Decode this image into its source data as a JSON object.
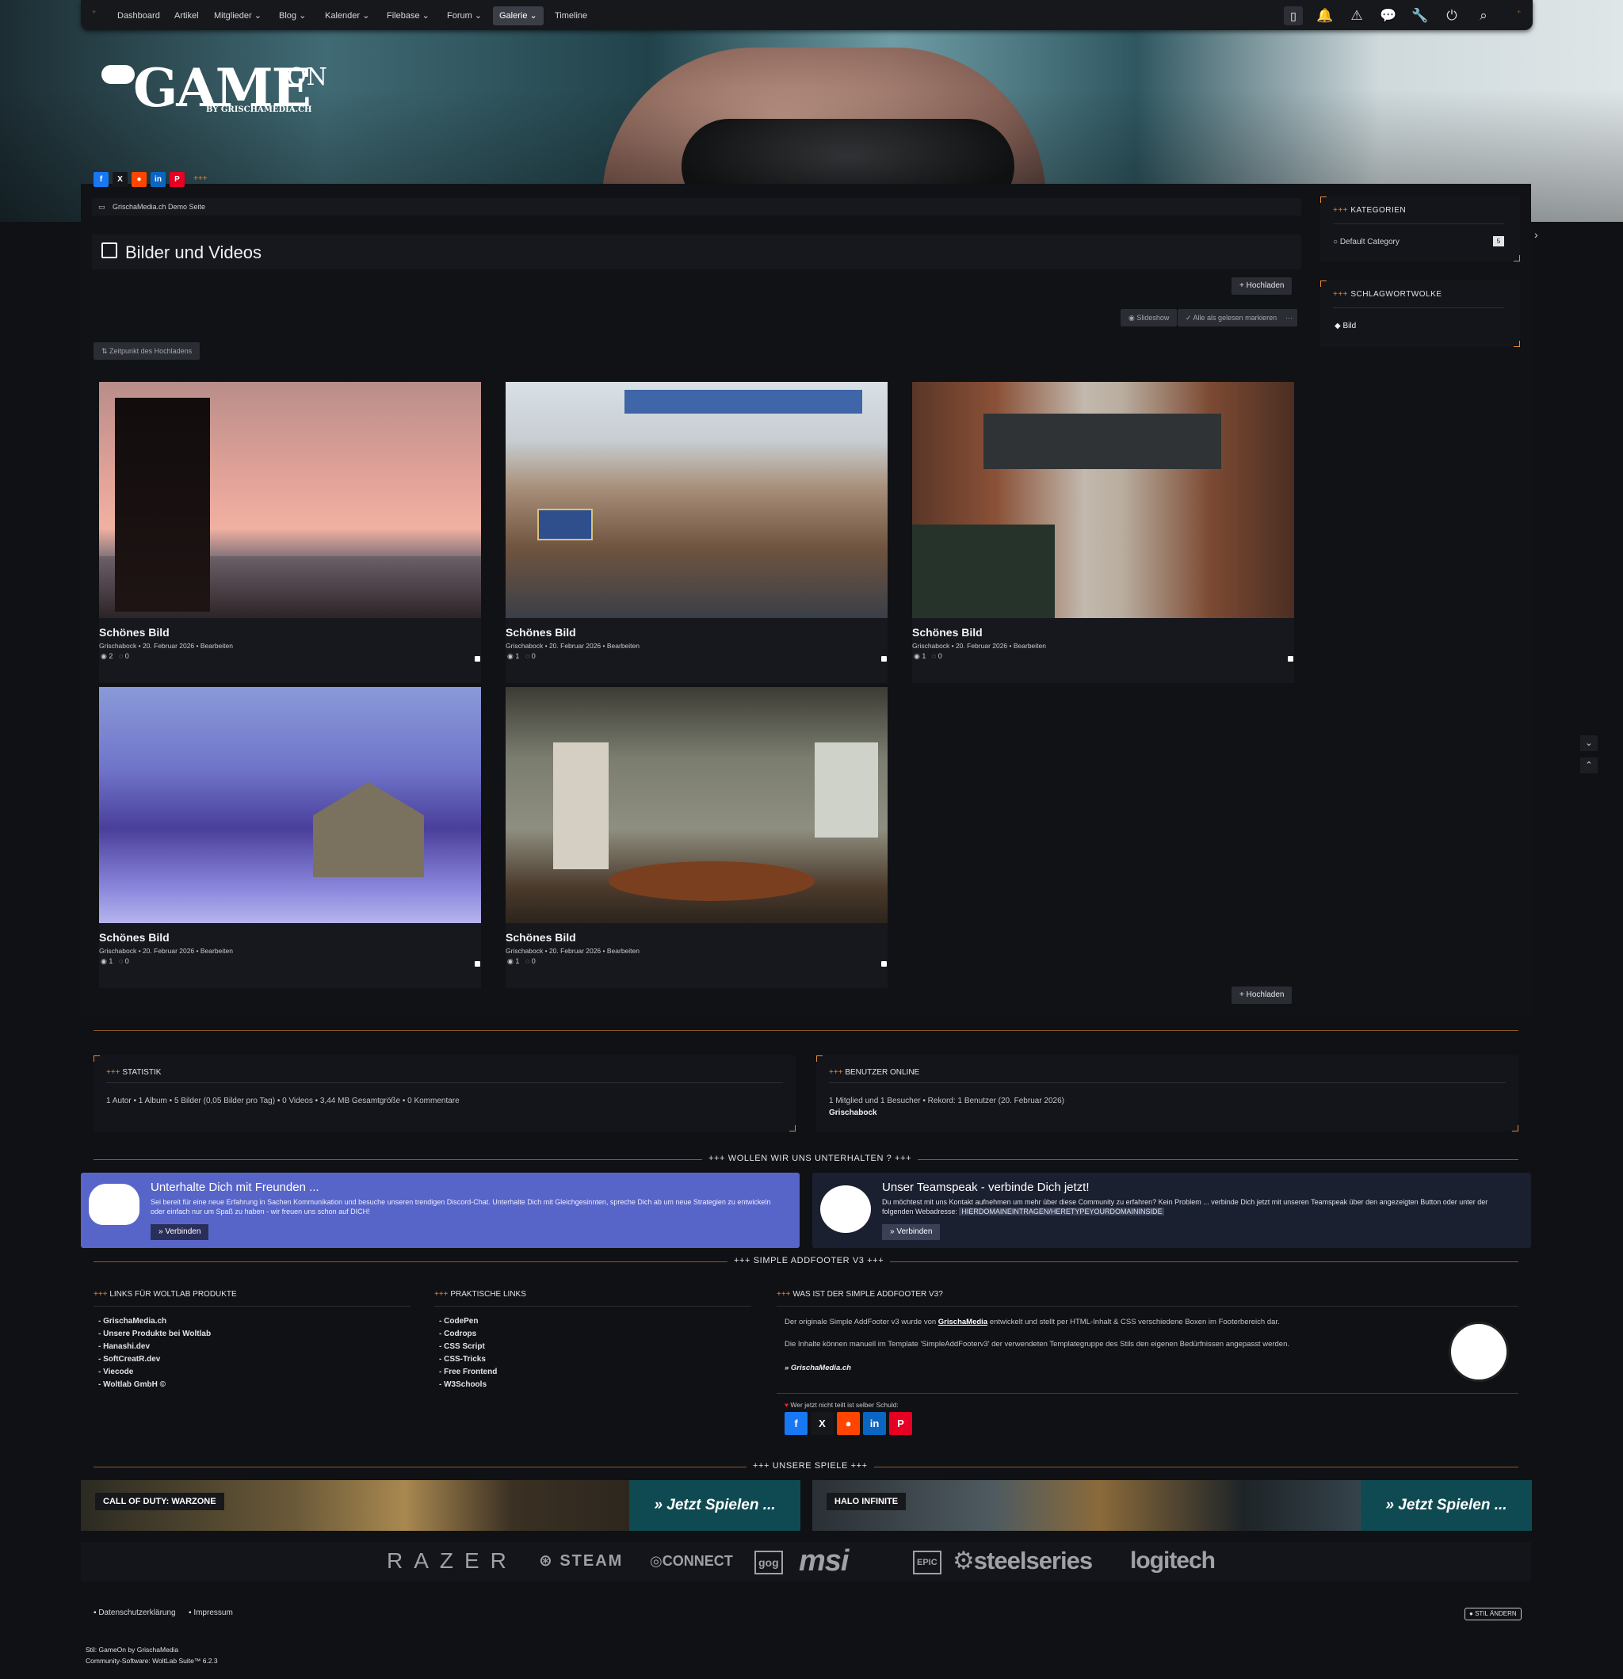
{
  "nav": {
    "items": [
      "Dashboard",
      "Artikel",
      "Mitglieder",
      "Blog",
      "Kalender",
      "Filebase",
      "Forum",
      "Galerie",
      "Timeline"
    ],
    "active": "Galerie",
    "icons": [
      "wsc-logo-icon",
      "bell-icon",
      "warning-icon",
      "chat-icon",
      "wrench-icon",
      "power-icon",
      "search-icon"
    ]
  },
  "logo": {
    "main": "GAMEON",
    "game": "GAME",
    "on": "ON",
    "by": "BY GRISCHAMEDIA.CH"
  },
  "share": {
    "more": "+++"
  },
  "breadcrumb": "GrischaMedia.ch Demo Seite",
  "page_title": "Bilder und Videos",
  "buttons": {
    "upload": "Hochladen",
    "slideshow": "Slideshow",
    "mark_read": "Alle als gelesen markieren",
    "more": "···",
    "sort": "Zeitpunkt des Hochladens"
  },
  "gallery": [
    {
      "title": "Schönes Bild",
      "author": "Grischabock",
      "date": "20. Februar 2026",
      "edit": "Bearbeiten",
      "views": "2",
      "comments": "0"
    },
    {
      "title": "Schönes Bild",
      "author": "Grischabock",
      "date": "20. Februar 2026",
      "edit": "Bearbeiten",
      "views": "1",
      "comments": "0"
    },
    {
      "title": "Schönes Bild",
      "author": "Grischabock",
      "date": "20. Februar 2026",
      "edit": "Bearbeiten",
      "views": "1",
      "comments": "0"
    },
    {
      "title": "Schönes Bild",
      "author": "Grischabock",
      "date": "20. Februar 2026",
      "edit": "Bearbeiten",
      "views": "1",
      "comments": "0"
    },
    {
      "title": "Schönes Bild",
      "author": "Grischabock",
      "date": "20. Februar 2026",
      "edit": "Bearbeiten",
      "views": "1",
      "comments": "0"
    }
  ],
  "sidebar": {
    "categories_title": "KATEGORIEN",
    "category": "Default Category",
    "category_count": "5",
    "tags_title": "SCHLAGWORTWOLKE",
    "tag": "Bild",
    "deco": "+++"
  },
  "stats": {
    "title": "STATISTIK",
    "text": "1 Autor • 1 Album • 5 Bilder (0,05 Bilder pro Tag) • 0 Videos • 3,44 MB Gesamtgröße • 0 Kommentare"
  },
  "online": {
    "title": "BENUTZER ONLINE",
    "text": "1 Mitglied und 1 Besucher • Rekord: 1 Benutzer (20. Februar 2026)",
    "user": "Grischabock"
  },
  "talk": {
    "heading": "+++ WOLLEN WIR UNS UNTERHALTEN ? +++"
  },
  "discord": {
    "title": "Unterhalte Dich mit Freunden ...",
    "text": "Sei bereit für eine neue Erfahrung in Sachen Kommunikation und besuche unseren trendigen Discord-Chat. Unterhalte Dich mit Gleichgesinnten, spreche Dich ab um neue Strategien zu entwickeln oder einfach nur um Spaß zu haben - wir freuen uns schon auf DICH!",
    "button": "» Verbinden"
  },
  "teamspeak": {
    "title": "Unser Teamspeak - verbinde Dich jetzt!",
    "text": "Du möchtest mit uns Kontakt aufnehmen um mehr über diese Community zu erfahren? Kein Problem ... verbinde Dich jetzt mit unseren Teamspeak über den angezeigten Button oder unter der folgenden Webadresse:",
    "address": "HIERDOMAINEINTRAGEN/HERETYPEYOURDOMAININSIDE",
    "button": "» Verbinden"
  },
  "footer": {
    "heading": "+++ SIMPLE ADDFOOTER V3 +++",
    "col1_title": "LINKS FÜR WOLTLAB PRODUKTE",
    "col1": [
      "GrischaMedia.ch",
      "Unsere Produkte bei Woltlab",
      "Hanashi.dev",
      "SoftCreatR.dev",
      "Viecode",
      "Woltlab GmbH ©"
    ],
    "col2_title": "PRAKTISCHE LINKS",
    "col2": [
      "CodePen",
      "Codrops",
      "CSS Script",
      "CSS-Tricks",
      "Free Frontend",
      "W3Schools"
    ],
    "col3_title": "WAS IST DER SIMPLE ADDFOOTER V3?",
    "col3_p1_a": "Der originale Simple AddFooter v3 wurde von ",
    "col3_p1_b": "GrischaMedia",
    "col3_p1_c": " entwickelt und stellt per HTML-Inhalt & CSS verschiedene Boxen im Footerbereich dar.",
    "col3_p2": "Die Inhalte können manuell im Template 'SimpleAddFooterv3' der verwendeten Templategruppe des Stils den eigenen Bedürfnissen angepasst werden.",
    "col3_sig": "» GrischaMedia.ch",
    "share_text": "Wer jetzt nicht teilt ist selber Schuld:"
  },
  "games": {
    "heading": "+++ UNSERE SPIELE +++",
    "items": [
      {
        "tag": "CALL OF DUTY: WARZONE",
        "play": "» Jetzt Spielen ..."
      },
      {
        "tag": "HALO INFINITE",
        "play": "» Jetzt Spielen ..."
      }
    ]
  },
  "brands": [
    "RAZER",
    "STEAM",
    "CONNECT",
    "gog",
    "msi",
    "EPIC",
    "steelseries",
    "logitech"
  ],
  "legal": {
    "privacy": "Datenschutzerklärung",
    "imprint": "Impressum",
    "style_btn": "STIL ÄNDERN"
  },
  "credits": {
    "style": "Stil: GameOn by GrischaMedia",
    "software": "Community-Software: WoltLab Suite™ 6.2.3"
  },
  "colors": {
    "accent": "#e08a3c",
    "discord": "#5865c8",
    "teamspeak": "#1b2030",
    "facebook": "#1877f2",
    "reddit": "#ff4500",
    "linkedin": "#0a66c2",
    "pinterest": "#e60023"
  }
}
